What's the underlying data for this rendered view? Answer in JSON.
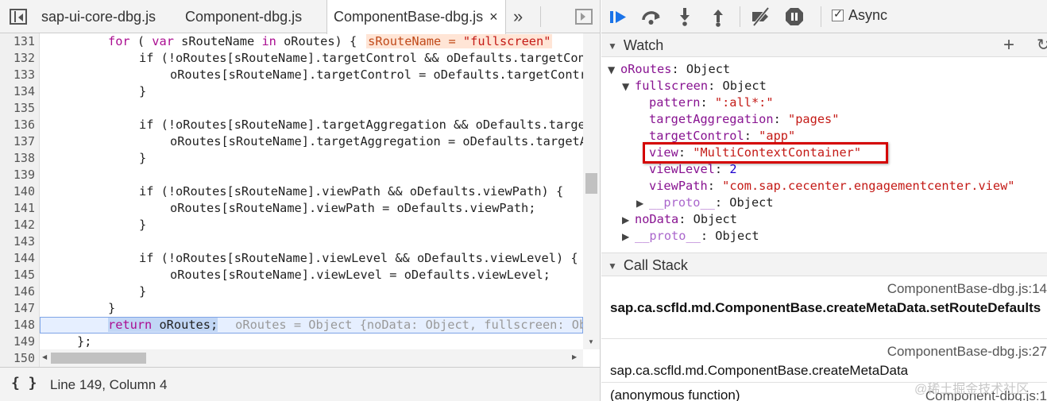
{
  "file_tabs": [
    {
      "label": "sap-ui-core-dbg.js"
    },
    {
      "label": "Component-dbg.js"
    },
    {
      "label": "ComponentBase-dbg.js",
      "close": "×"
    }
  ],
  "more_tabs": "»",
  "code": {
    "line_numbers": [
      "131",
      "132",
      "133",
      "134",
      "135",
      "136",
      "137",
      "138",
      "139",
      "140",
      "141",
      "142",
      "143",
      "144",
      "145",
      "146",
      "147",
      "148",
      "149",
      "150"
    ],
    "lines": {
      "l131_kw1": "for",
      "l131_a": " ( ",
      "l131_kw2": "var",
      "l131_b": " sRouteName ",
      "l131_kw3": "in",
      "l131_c": " oRoutes) {",
      "l131_inline_name": "sRouteName = ",
      "l131_inline_val": "\"fullscreen\"",
      "l132": "if (!oRoutes[sRouteName].targetControl && oDefaults.targetControl) {",
      "l133": "oRoutes[sRouteName].targetControl = oDefaults.targetControl;",
      "l134": "}",
      "l136": "if (!oRoutes[sRouteName].targetAggregation && oDefaults.targetAggregation) {",
      "l137": "oRoutes[sRouteName].targetAggregation = oDefaults.targetAggregation;",
      "l138": "}",
      "l140": "if (!oRoutes[sRouteName].viewPath && oDefaults.viewPath) {",
      "l141": "oRoutes[sRouteName].viewPath = oDefaults.viewPath;",
      "l142": "}",
      "l144": "if (!oRoutes[sRouteName].viewLevel && oDefaults.viewLevel) {",
      "l145": "oRoutes[sRouteName].viewLevel = oDefaults.viewLevel;",
      "l146": "}",
      "l147": "}",
      "l148_kw": "return",
      "l148_rest": " oRoutes;",
      "l148_eval": "oRoutes = Object {noData: Object, fullscreen: Object}",
      "l149": "};",
      "l150": ""
    }
  },
  "status": {
    "pretty_print": "{ }",
    "position": "Line 149, Column 4"
  },
  "debugger": {
    "async_label": "Async",
    "async_checked": true
  },
  "watch": {
    "title": "Watch",
    "add": "+",
    "refresh": "↻",
    "items": {
      "oroutes_name": "oRoutes",
      "oroutes_val": ": Object",
      "fullscreen_name": "fullscreen",
      "fullscreen_val": ": Object",
      "pattern_name": "pattern",
      "pattern_val": "\":all*:\"",
      "targetagg_name": "targetAggregation",
      "targetagg_val": "\"pages\"",
      "targetctrl_name": "targetControl",
      "targetctrl_val": "\"app\"",
      "view_name": "view",
      "view_val": "\"MultiContextContainer\"",
      "viewlevel_name": "viewLevel",
      "viewlevel_val": "2",
      "viewpath_name": "viewPath",
      "viewpath_val": "\"com.sap.cecenter.engagementcenter.view\"",
      "proto1_name": "__proto__",
      "proto1_val": ": Object",
      "nodata_name": "noData",
      "nodata_val": ": Object",
      "proto2_name": "__proto__",
      "proto2_val": ": Object"
    }
  },
  "call_stack": {
    "title": "Call Stack",
    "frames": [
      {
        "file": "ComponentBase-dbg.js:14",
        "fn": "sap.ca.scfld.md.ComponentBase.createMetaData.setRouteDefaults"
      },
      {
        "file": "ComponentBase-dbg.js:27",
        "fn": "sap.ca.scfld.md.ComponentBase.createMetaData"
      },
      {
        "file": "Component-dbg.js:1",
        "fn": "(anonymous function)"
      }
    ]
  },
  "watermark": "@稀土掘金技术社区"
}
